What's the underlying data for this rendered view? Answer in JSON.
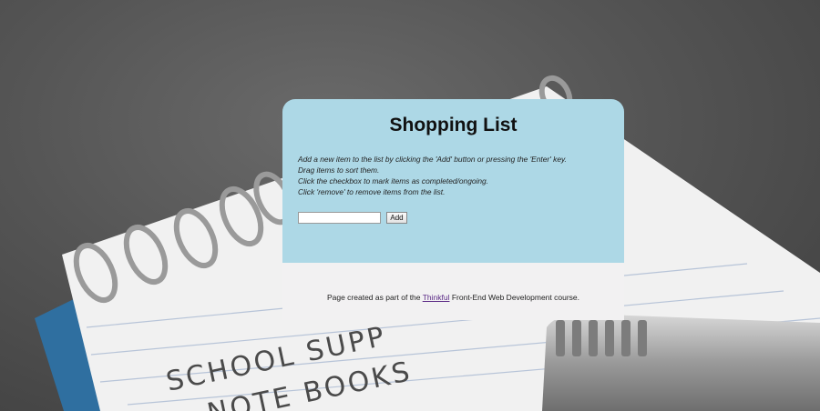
{
  "page": {
    "title": "Shopping List"
  },
  "instructions": [
    "Add a new item to the list by clicking the 'Add' button or pressing the 'Enter' key.",
    "Drag items to sort them.",
    "Click the checkbox to mark items as completed/ongoing.",
    "Click 'remove' to remove items from the list."
  ],
  "form": {
    "item_value": "",
    "add_label": "Add"
  },
  "footer": {
    "prefix": "Page created as part of the ",
    "link_text": "Thinkful",
    "suffix": " Front-End Web Development course."
  },
  "background": {
    "notebook_text_line1": "SCHOOL SUPP",
    "notebook_text_line2": "NOTE BOOKS"
  },
  "colors": {
    "card_top": "#add8e6",
    "card_bottom": "#f2f1f2",
    "link": "#5b2a86"
  }
}
